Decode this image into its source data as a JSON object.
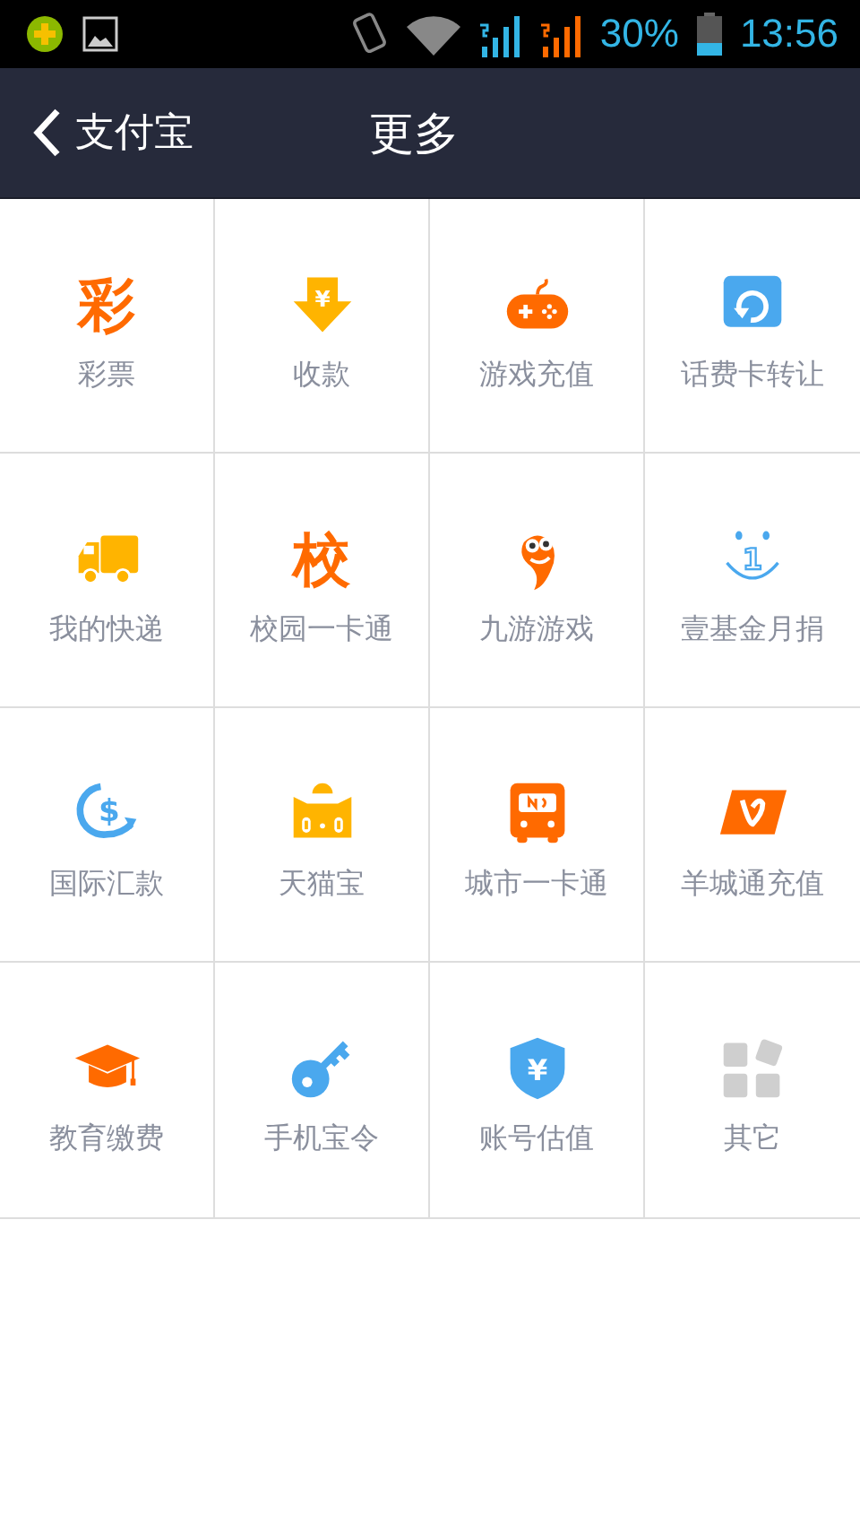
{
  "status_bar": {
    "battery_percent": "30%",
    "time": "13:56"
  },
  "header": {
    "back_label": "支付宝",
    "title": "更多"
  },
  "services": [
    {
      "label": "彩票",
      "kind": "char",
      "glyph": "彩"
    },
    {
      "label": "收款",
      "kind": "yen-arrow",
      "glyph": "¥"
    },
    {
      "label": "游戏充值",
      "kind": "gamepad"
    },
    {
      "label": "话费卡转让",
      "kind": "refresh"
    },
    {
      "label": "我的快递",
      "kind": "truck"
    },
    {
      "label": "校园一卡通",
      "kind": "char",
      "glyph": "校"
    },
    {
      "label": "九游游戏",
      "kind": "mascot"
    },
    {
      "label": "壹基金月捐",
      "kind": "smiley",
      "glyph": "1"
    },
    {
      "label": "国际汇款",
      "kind": "dollar-arrow",
      "glyph": "$"
    },
    {
      "label": "天猫宝",
      "kind": "cat-bag"
    },
    {
      "label": "城市一卡通",
      "kind": "bus"
    },
    {
      "label": "羊城通充值",
      "kind": "card"
    },
    {
      "label": "教育缴费",
      "kind": "cap"
    },
    {
      "label": "手机宝令",
      "kind": "key"
    },
    {
      "label": "账号估值",
      "kind": "shield",
      "glyph": "¥"
    },
    {
      "label": "其它",
      "kind": "tiles"
    }
  ]
}
